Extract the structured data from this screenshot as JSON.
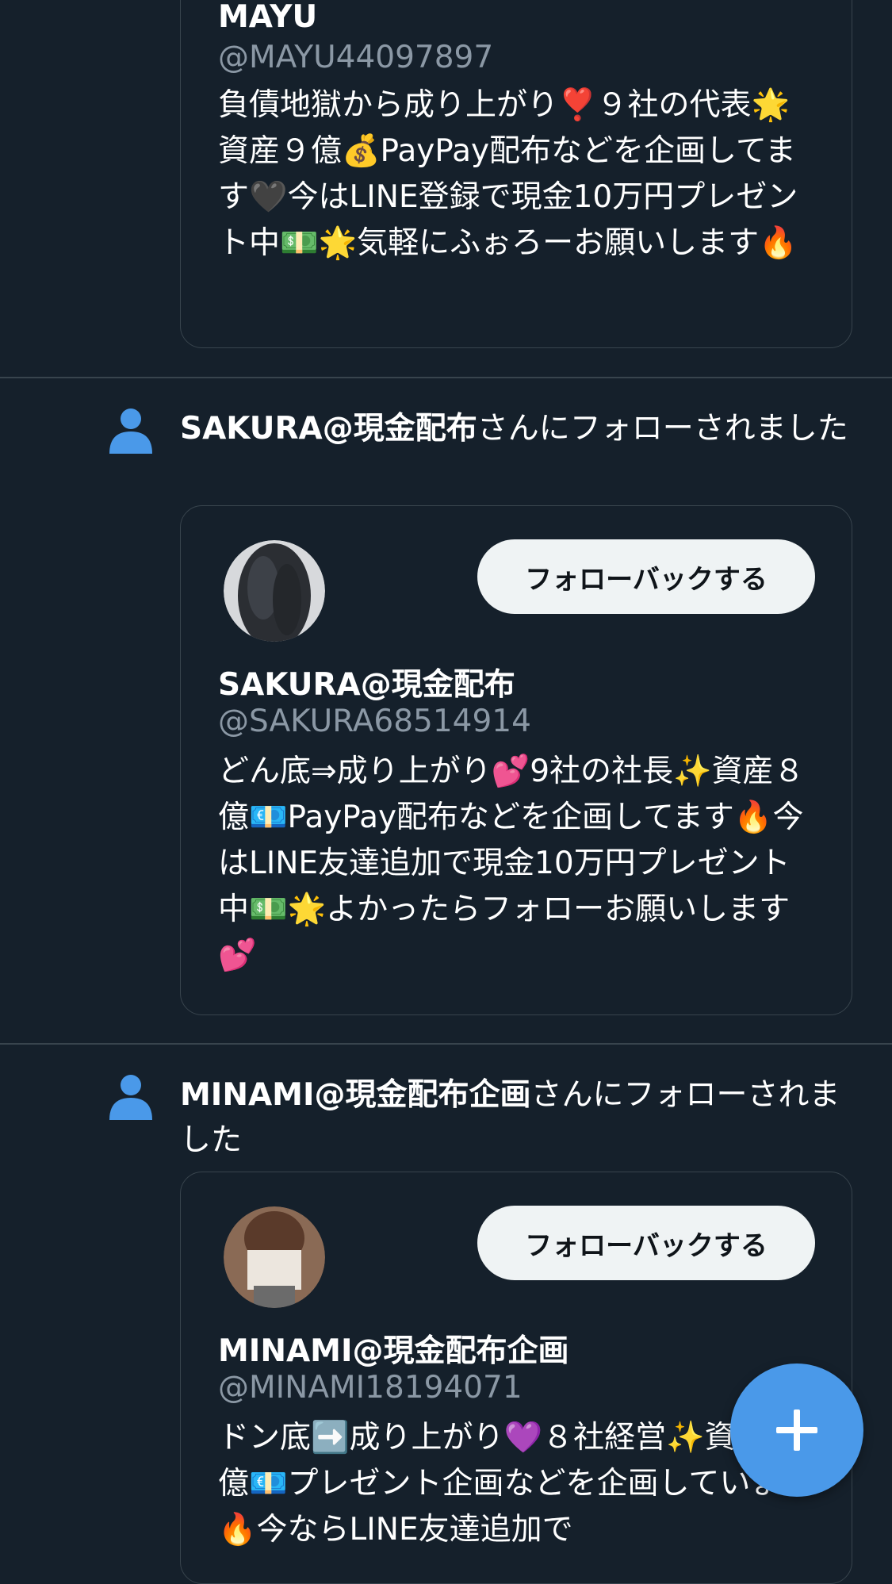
{
  "mayu": {
    "name": "MAYU",
    "handle": "@MAYU44097897",
    "bio": "負債地獄から成り上がり❣️９社の代表🌟資産９億💰PayPay配布などを企画してます🖤今はLINE登録で現金10万円プレゼント中💵🌟気軽にふぉろーお願いします🔥"
  },
  "sakura": {
    "notif_name": "SAKURA@現金配布",
    "notif_suffix": "さんにフォローされました",
    "name": "SAKURA@現金配布",
    "handle": "@SAKURA68514914",
    "follow_back_label": "フォローバックする",
    "bio": "どん底⇒成り上がり💕9社の社長✨資産８億💶PayPay配布などを企画してます🔥今はLINE友達追加で現金10万円プレゼント中💵🌟よかったらフォローお願いします💕"
  },
  "minami": {
    "notif_name": "MINAMI@現金配布企画",
    "notif_suffix": "さんにフォローされました",
    "name": "MINAMI@現金配布企画",
    "handle": "@MINAMI18194071",
    "follow_back_label": "フォローバックする",
    "bio": "ドン底➡️成り上がり💜８社経営✨資産30億💶プレゼント企画などを企画しています🔥今ならLINE友達追加で"
  },
  "fab": {
    "icon": "plus-icon"
  },
  "colors": {
    "background": "#15202b",
    "border": "#38444d",
    "accent": "#4a99e9",
    "secondary_text": "#8b98a5",
    "button_bg": "#eff3f4"
  }
}
